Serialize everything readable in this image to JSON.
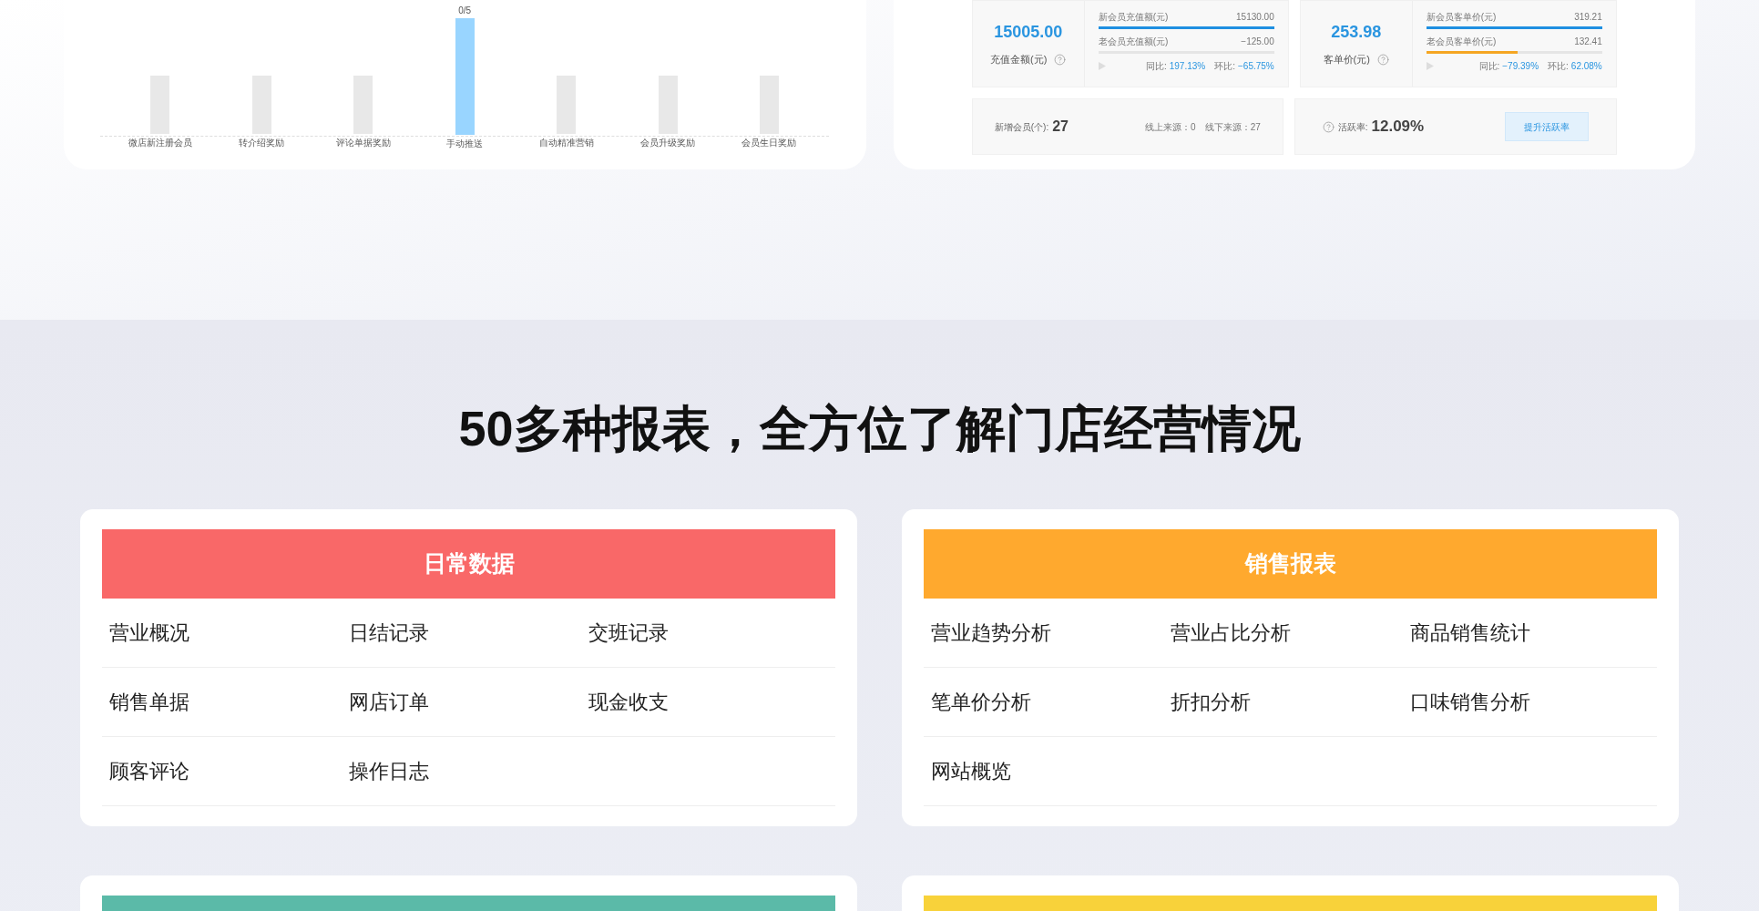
{
  "reward_chart": {
    "data_label": "0/5",
    "bars": [
      {
        "label": "微店新注册会员",
        "selected": false
      },
      {
        "label": "转介绍奖励",
        "selected": false
      },
      {
        "label": "评论单据奖励",
        "selected": false
      },
      {
        "label": "手动推送",
        "selected": true
      },
      {
        "label": "自动精准营销",
        "selected": false
      },
      {
        "label": "会员升级奖励",
        "selected": false
      },
      {
        "label": "会员生日奖励",
        "selected": false
      }
    ]
  },
  "member_stats": {
    "metrics": [
      {
        "value": "15005.00",
        "label": "充值金额(元)",
        "rows": [
          {
            "label": "新会员充值额(元)",
            "value": "15130.00",
            "level": 1,
            "color": "#1e8fe1"
          },
          {
            "label": "老会员充值额(元)",
            "value": "−125.00"
          }
        ],
        "yoy_label": "同比:",
        "yoy": "197.13%",
        "mom_label": "环比:",
        "mom": "−65.75%"
      },
      {
        "value": "253.98",
        "label": "客单价(元)",
        "rows": [
          {
            "label": "新会员客单价(元)",
            "value": "319.21",
            "level": 1,
            "color": "#1e8fe1"
          },
          {
            "label": "老会员客单价(元)",
            "value": "132.41",
            "level": 0.52,
            "color": "#f5a623"
          }
        ],
        "yoy_label": "同比:",
        "yoy": "−79.39%",
        "mom_label": "环比:",
        "mom": "62.08%"
      }
    ],
    "new_members": {
      "label": "新增会员(个):",
      "value": "27",
      "online": "线上来源：0",
      "offline": "线下来源：27"
    },
    "activity": {
      "label": "活跃率:",
      "value": "12.09%",
      "button": "提升活跃率"
    }
  },
  "reports": {
    "title": "50多种报表，全方位了解门店经营情况",
    "cards": [
      {
        "title": "日常数据",
        "color": "#f96868",
        "items": [
          "营业概况",
          "日结记录",
          "交班记录",
          "销售单据",
          "网店订单",
          "现金收支",
          "顾客评论",
          "操作日志"
        ]
      },
      {
        "title": "销售报表",
        "color": "#ffa92e",
        "items": [
          "营业趋势分析",
          "营业占比分析",
          "商品销售统计",
          "笔单价分析",
          "折扣分析",
          "口味销售分析",
          "网站概览"
        ]
      },
      {
        "color": "#5bbaa8"
      },
      {
        "color": "#f8d23a"
      }
    ]
  }
}
